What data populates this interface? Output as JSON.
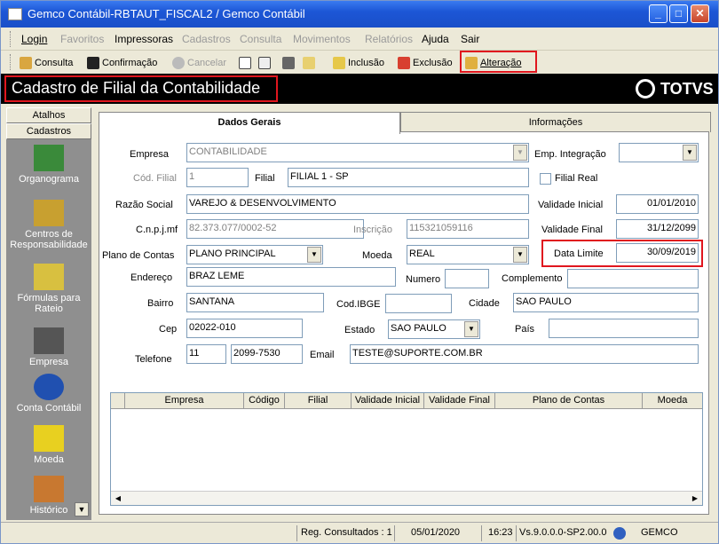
{
  "window": {
    "title": "Gemco Contábil-RBTAUT_FISCAL2 / Gemco Contábil"
  },
  "menu": [
    "Login",
    "Favoritos",
    "Impressoras",
    "Cadastros",
    "Consulta",
    "Movimentos",
    "Relatórios",
    "Ajuda",
    "Sair"
  ],
  "toolbar": {
    "consulta": "Consulta",
    "confirmacao": "Confirmação",
    "cancelar": "Cancelar",
    "inclusao": "Inclusão",
    "exclusao": "Exclusão",
    "alteracao": "Alteração"
  },
  "banner": {
    "title": "Cadastro de Filial da Contabilidade",
    "logo": "TOTVS"
  },
  "sidebar": {
    "atalhos": "Atalhos",
    "cadastros": "Cadastros",
    "items": [
      "Organograma",
      "Centros de Responsabilidade",
      "Fórmulas para Rateio",
      "Empresa",
      "Conta Contábil",
      "Moeda",
      "Histórico"
    ]
  },
  "tabs": {
    "dados": "Dados Gerais",
    "info": "Informações"
  },
  "form": {
    "empresa_lbl": "Empresa",
    "empresa": "CONTABILIDADE",
    "empint_lbl": "Emp. Integração",
    "empint": "",
    "codfilial_lbl": "Cód. Filial",
    "codfilial": "1",
    "filial_lbl": "Filial",
    "filial": "FILIAL 1 - SP",
    "filialreal_lbl": "Filial Real",
    "razao_lbl": "Razão Social",
    "razao": "VAREJO & DESENVOLVIMENTO",
    "valini_lbl": "Validade Inicial",
    "valini": "01/01/2010",
    "cnpj_lbl": "C.n.p.j.mf",
    "cnpj": "82.373.077/0002-52",
    "insc_lbl": "Inscrição",
    "insc": "115321059116",
    "valfim_lbl": "Validade Final",
    "valfim": "31/12/2099",
    "plano_lbl": "Plano de Contas",
    "plano": "PLANO PRINCIPAL",
    "moeda_lbl": "Moeda",
    "moeda": "REAL",
    "datalim_lbl": "Data Limite",
    "datalim": "30/09/2019",
    "end_lbl": "Endereço",
    "end": "BRAZ LEME",
    "num_lbl": "Numero",
    "num": "",
    "compl_lbl": "Complemento",
    "compl": "",
    "bairro_lbl": "Bairro",
    "bairro": "SANTANA",
    "ibge_lbl": "Cod.IBGE",
    "ibge": "",
    "cidade_lbl": "Cidade",
    "cidade": "SAO PAULO",
    "cep_lbl": "Cep",
    "cep": "02022-010",
    "estado_lbl": "Estado",
    "estado": "SAO PAULO",
    "pais_lbl": "País",
    "pais": "",
    "tel_lbl": "Telefone",
    "ddd": "11",
    "tel": "2099-7530",
    "email_lbl": "Email",
    "email": "TESTE@SUPORTE.COM.BR"
  },
  "grid": {
    "columns": [
      "Empresa",
      "Código",
      "Filial",
      "Validade Inicial",
      "Validade Final",
      "Plano de Contas",
      "Moeda"
    ]
  },
  "status": {
    "reg": "Reg. Consultados : 1",
    "date": "05/01/2020",
    "time": "16:23",
    "version": "Vs.9.0.0.0-SP2.00.0",
    "app": "GEMCO"
  }
}
